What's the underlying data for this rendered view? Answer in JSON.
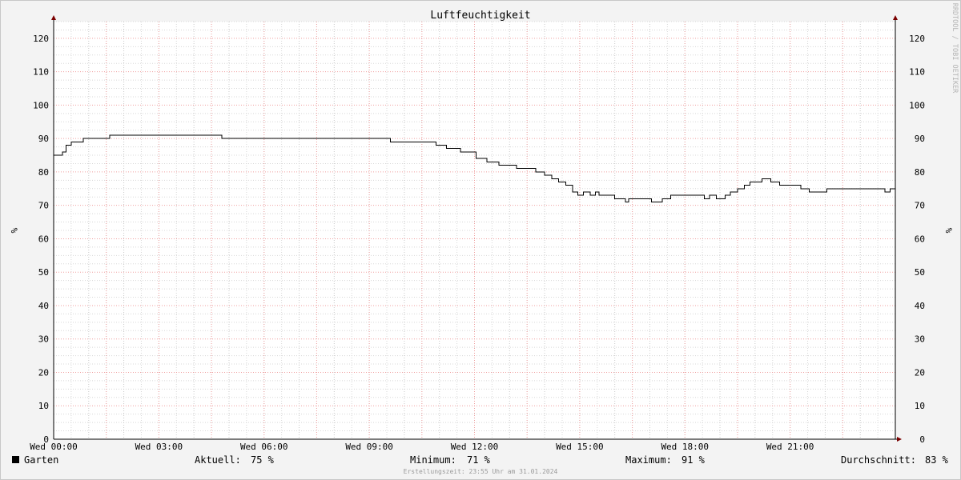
{
  "vertical_credit": "RRDTOOL / TOBI OETIKER",
  "footer": "Erstellungszeit: 23:55 Uhr am 31.01.2024",
  "legend": {
    "series_name": "Garten",
    "series_color": "#000000",
    "current_label": "Aktuell:",
    "current_value": "75 %",
    "min_label": "Minimum:",
    "min_value": "71 %",
    "max_label": "Maximum:",
    "max_value": "91 %",
    "avg_label": "Durchschnitt:",
    "avg_value": "83 %"
  },
  "chart_data": {
    "type": "line",
    "title": "Luftfeuchtigkeit",
    "ylabel": "%",
    "ylabel_right": "%",
    "xlabel": "",
    "xlim": [
      0,
      24
    ],
    "ylim": [
      0,
      125
    ],
    "y_ticks": [
      0,
      10,
      20,
      30,
      40,
      50,
      60,
      70,
      80,
      90,
      100,
      110,
      120
    ],
    "x_ticks": [
      {
        "x": 0,
        "label": "Wed 00:00"
      },
      {
        "x": 3,
        "label": "Wed 03:00"
      },
      {
        "x": 6,
        "label": "Wed 06:00"
      },
      {
        "x": 9,
        "label": "Wed 09:00"
      },
      {
        "x": 12,
        "label": "Wed 12:00"
      },
      {
        "x": 15,
        "label": "Wed 15:00"
      },
      {
        "x": 18,
        "label": "Wed 18:00"
      },
      {
        "x": 21,
        "label": "Wed 21:00"
      }
    ],
    "grid": true,
    "series": [
      {
        "name": "Garten",
        "color": "#000000",
        "step": true,
        "x": [
          0,
          0.25,
          0.35,
          0.5,
          0.85,
          1.6,
          4.8,
          9.6,
          10.9,
          11.2,
          11.6,
          12.05,
          12.35,
          12.7,
          13.2,
          13.75,
          14.0,
          14.2,
          14.4,
          14.6,
          14.8,
          14.95,
          15.1,
          15.3,
          15.45,
          15.55,
          15.6,
          16.0,
          16.3,
          16.4,
          17.05,
          17.35,
          17.6,
          18.55,
          18.7,
          18.9,
          19.15,
          19.3,
          19.5,
          19.7,
          19.85,
          20.0,
          20.2,
          20.45,
          20.7,
          21.3,
          21.55,
          21.95,
          22.05,
          23.7,
          23.85,
          24.0
        ],
        "y": [
          85,
          86,
          88,
          89,
          90,
          91,
          90,
          89,
          88,
          87,
          86,
          84,
          83,
          82,
          81,
          80,
          79,
          78,
          77,
          76,
          74,
          73,
          74,
          73,
          74,
          73,
          73,
          72,
          71,
          72,
          71,
          72,
          73,
          72,
          73,
          72,
          73,
          74,
          75,
          76,
          77,
          77,
          78,
          77,
          76,
          75,
          74,
          74,
          75,
          74,
          75,
          75
        ]
      }
    ]
  }
}
